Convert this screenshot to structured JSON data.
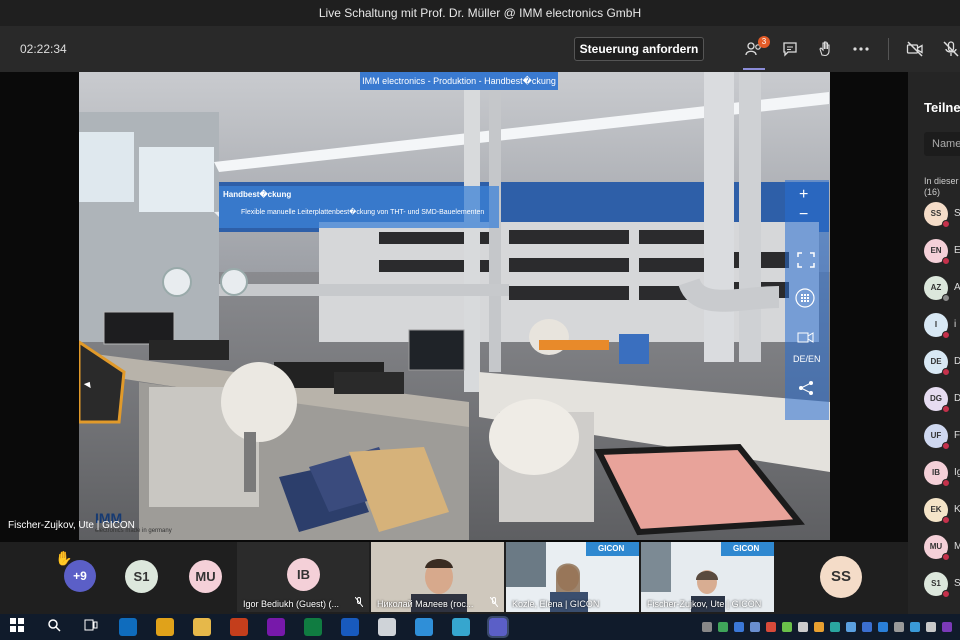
{
  "window": {
    "title": "Live Schaltung mit Prof. Dr. Müller @ IMM electronics GmbH"
  },
  "toolbar": {
    "timer": "02:22:34",
    "control_label": "Steuerung anfordern",
    "participants_badge": "3",
    "icons": [
      "people-icon",
      "chat-icon",
      "raise-hand-icon",
      "more-icon",
      "camera-off-icon",
      "mic-off-icon"
    ]
  },
  "video": {
    "banner": "IMM electronics - Produktion - Handbest�ckung",
    "hotspot_title": "Handbest�ckung",
    "hotspot_desc": "Flexible manuelle Leiterplattenbest�ckung von THT- und SMD-Bauelementen",
    "presenter_label": "Fischer-Zujkov, Ute | GICON",
    "logo_text": "IMM",
    "logo_sub": "electronics made in germany",
    "nav": {
      "zoom_in": "+",
      "zoom_out": "−",
      "lang": "DE/EN"
    }
  },
  "panel": {
    "title": "Teilnehmer",
    "search_placeholder": "Name",
    "section_label": "In dieser",
    "section_count": "(16)",
    "participants": [
      {
        "initials": "SS",
        "name": "S",
        "color": "#f4dcc8",
        "status": "#c4314b"
      },
      {
        "initials": "EN",
        "name": "E",
        "color": "#f4d0d8",
        "status": "#c4314b"
      },
      {
        "initials": "AZ",
        "name": "A",
        "color": "#dce7dc",
        "status": "#8a8a8a"
      },
      {
        "initials": "I",
        "name": "i",
        "color": "#d8e8f4",
        "status": "#c4314b"
      },
      {
        "initials": "DE",
        "name": "D",
        "color": "#d8e8f4",
        "status": "#c4314b"
      },
      {
        "initials": "DG",
        "name": "D",
        "color": "#e6dcf0",
        "status": "#c4314b"
      },
      {
        "initials": "UF",
        "name": "F",
        "color": "#cfd8f0",
        "status": "#c4314b"
      },
      {
        "initials": "IB",
        "name": "Ig",
        "color": "#f4d0d8",
        "status": "#c4314b"
      },
      {
        "initials": "EK",
        "name": "K",
        "color": "#f4e4c8",
        "status": "#c4314b"
      },
      {
        "initials": "MU",
        "name": "M",
        "color": "#f4d0d8",
        "status": "#c4314b"
      },
      {
        "initials": "S1",
        "name": "S",
        "color": "#dce7dc",
        "status": "#c4314b"
      }
    ]
  },
  "gallery": {
    "overflow_count": "+9",
    "raised_hand_icon": "✋",
    "avatars": [
      {
        "initials": "S1",
        "color": "#dce7dc"
      },
      {
        "initials": "MU",
        "color": "#f4d0d8"
      }
    ],
    "tiles": [
      {
        "initials": "IB",
        "label": "Igor Bediukh (Guest) (...",
        "color": "#f4d0d8"
      },
      {
        "label": "Николай Малеев (гос..."
      },
      {
        "label": "Kozle, Elena | GICON",
        "brand": "GICON"
      },
      {
        "label": "Fischer-Zujkov, Ute | GICON",
        "brand": "GICON"
      }
    ],
    "self": {
      "initials": "SS",
      "color": "#f4dcc8"
    }
  },
  "taskbar": {
    "apps": [
      {
        "icon": "windows-start-icon",
        "color": "#ffffff"
      },
      {
        "icon": "search-icon",
        "color": "#ffffff"
      },
      {
        "icon": "task-view-icon",
        "color": "#ffffff"
      },
      {
        "icon": "outlook-icon",
        "color": "#0f6cbd"
      },
      {
        "icon": "chrome-icon",
        "color": "#e0a21a"
      },
      {
        "icon": "file-explorer-icon",
        "color": "#e6b84a"
      },
      {
        "icon": "powerpoint-icon",
        "color": "#c43e1c"
      },
      {
        "icon": "onenote-icon",
        "color": "#7719aa"
      },
      {
        "icon": "excel-icon",
        "color": "#107c41"
      },
      {
        "icon": "word-icon",
        "color": "#185abd"
      },
      {
        "icon": "paint-icon",
        "color": "#cfd3d8"
      },
      {
        "icon": "mail-icon",
        "color": "#2f8fd8"
      },
      {
        "icon": "browser-icon",
        "color": "#36a6ce"
      },
      {
        "icon": "teams-icon",
        "color": "#5b5fc7"
      }
    ]
  }
}
